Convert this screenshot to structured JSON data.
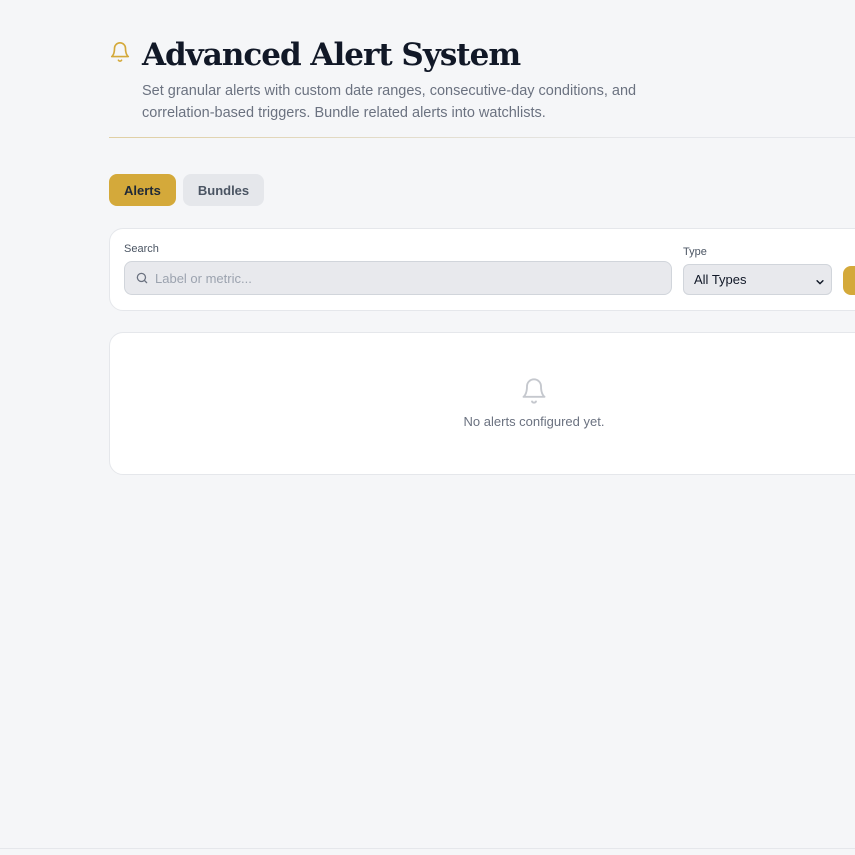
{
  "header": {
    "title": "Advanced Alert System",
    "subtitle": "Set granular alerts with custom date ranges, consecutive-day conditions, and correlation-based triggers. Bundle related alerts into watchlists.",
    "icon": "bell-icon"
  },
  "tabs": [
    {
      "label": "Alerts",
      "active": true
    },
    {
      "label": "Bundles",
      "active": false
    }
  ],
  "filters": {
    "search_label": "Search",
    "search_placeholder": "Label or metric...",
    "search_value": "",
    "type_label": "Type",
    "type_selected": "All Types"
  },
  "empty_state": {
    "icon": "bell-icon",
    "message": "No alerts configured yet."
  },
  "colors": {
    "accent": "#d4a93a",
    "background": "#f5f6f8",
    "card": "#ffffff"
  }
}
